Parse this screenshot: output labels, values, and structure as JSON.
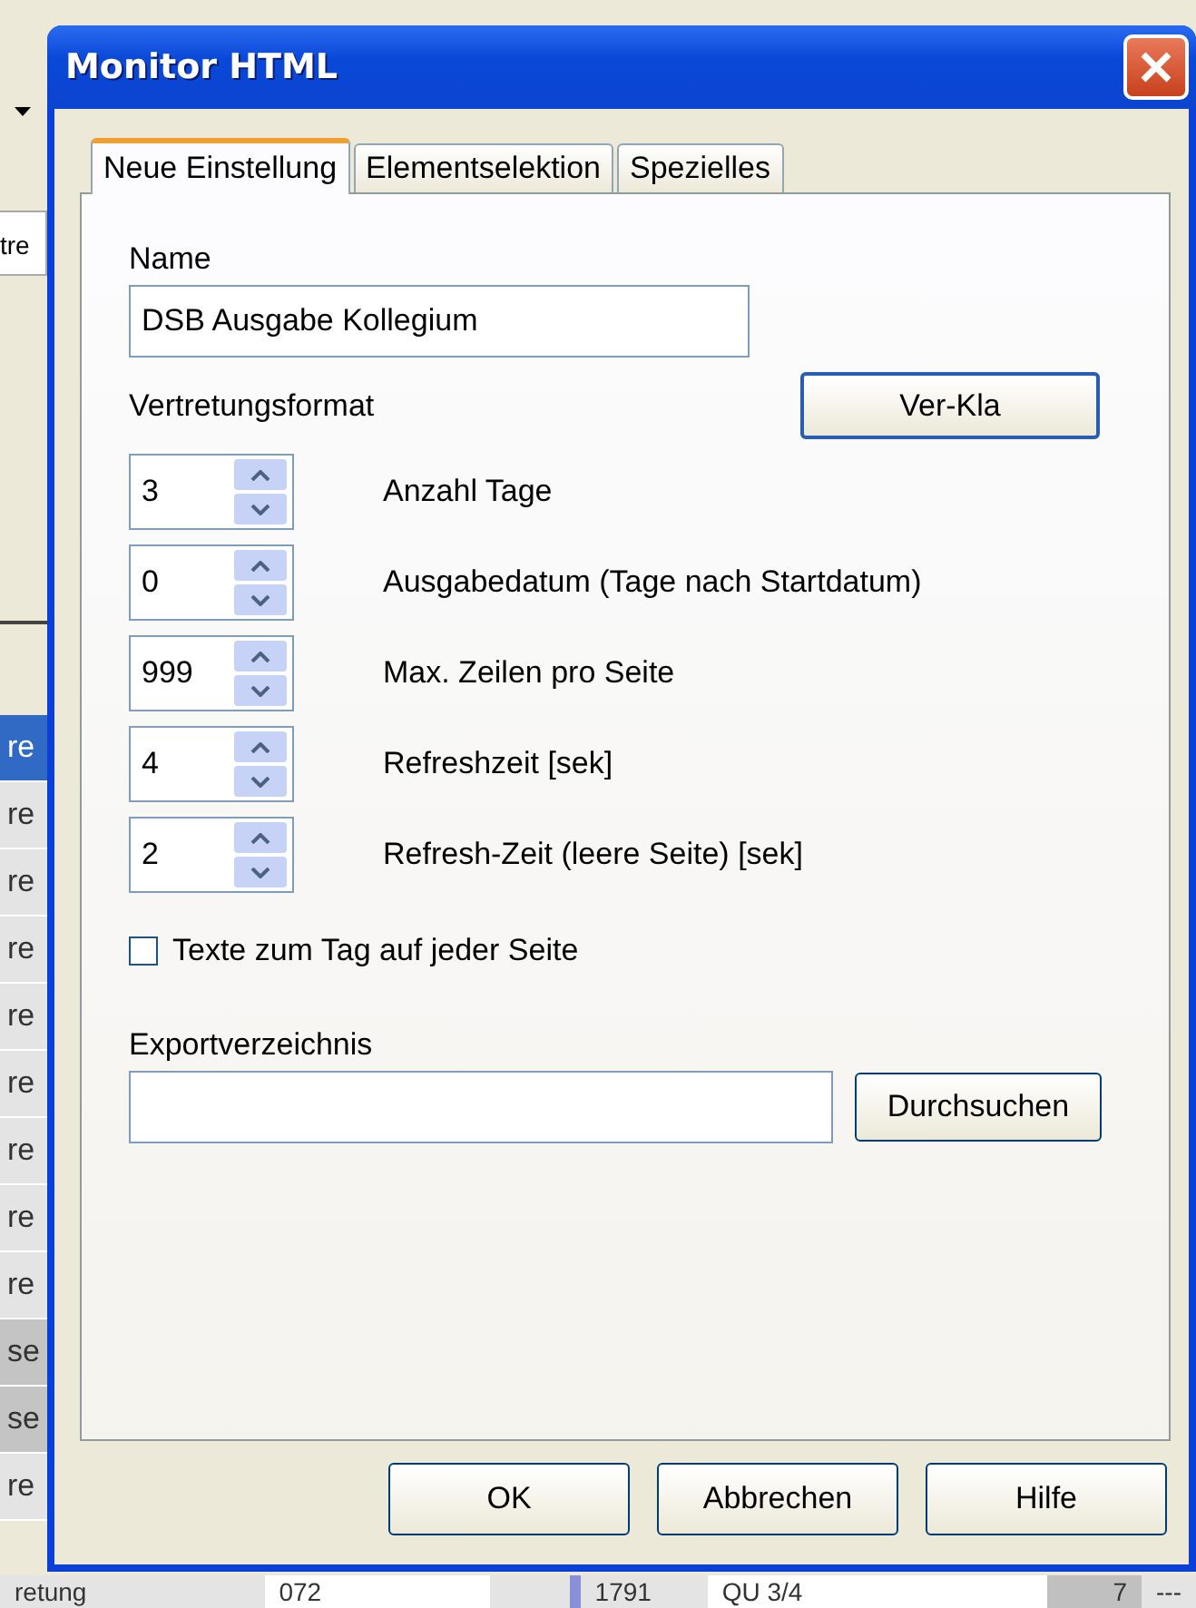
{
  "background_window": {
    "field_text": "tre",
    "rows": [
      {
        "text": "re",
        "selected": true,
        "shaded": false
      },
      {
        "text": "re",
        "selected": false,
        "shaded": false
      },
      {
        "text": "re",
        "selected": false,
        "shaded": false
      },
      {
        "text": "re",
        "selected": false,
        "shaded": false
      },
      {
        "text": "re",
        "selected": false,
        "shaded": false
      },
      {
        "text": "re",
        "selected": false,
        "shaded": false
      },
      {
        "text": "re",
        "selected": false,
        "shaded": false
      },
      {
        "text": "re",
        "selected": false,
        "shaded": false
      },
      {
        "text": "re",
        "selected": false,
        "shaded": false
      },
      {
        "text": "se",
        "selected": false,
        "shaded": true
      },
      {
        "text": "se",
        "selected": false,
        "shaded": true
      },
      {
        "text": "re",
        "selected": false,
        "shaded": false
      }
    ],
    "bottom_row": [
      "retung",
      "072",
      "1791",
      "QU 3/4",
      "7",
      "---"
    ]
  },
  "window": {
    "title": "Monitor HTML"
  },
  "tabs": [
    {
      "label": "Neue Einstellung",
      "selected": true
    },
    {
      "label": "Elementselektion",
      "selected": false
    },
    {
      "label": "Spezielles",
      "selected": false
    }
  ],
  "name": {
    "label": "Name",
    "value": "DSB Ausgabe Kollegium"
  },
  "format": {
    "label": "Vertretungsformat",
    "button": "Ver-Kla"
  },
  "spinners": [
    {
      "value": "3",
      "label": "Anzahl Tage"
    },
    {
      "value": "0",
      "label": "Ausgabedatum (Tage nach Startdatum)"
    },
    {
      "value": "999",
      "label": "Max. Zeilen pro Seite"
    },
    {
      "value": "4",
      "label": "Refreshzeit [sek]"
    },
    {
      "value": "2",
      "label": "Refresh-Zeit (leere Seite) [sek]"
    }
  ],
  "checkbox": {
    "label": "Texte zum Tag auf jeder Seite",
    "checked": false
  },
  "export": {
    "label": "Exportverzeichnis",
    "button": "Durchsuchen"
  },
  "buttons": [
    "OK",
    "Abbrechen",
    "Hilfe"
  ]
}
